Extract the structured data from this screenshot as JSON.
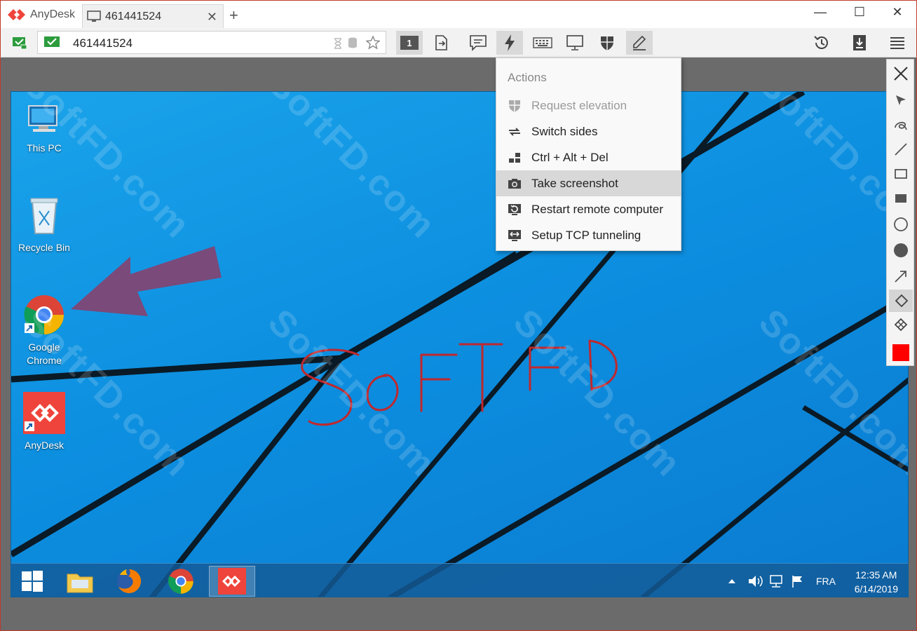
{
  "app": {
    "name": "AnyDesk"
  },
  "tab": {
    "label": "461441524",
    "close": "✕",
    "new_tab": "+"
  },
  "window_controls": {
    "minimize": "—",
    "maximize": "☐",
    "close": "✕"
  },
  "address": {
    "value": "461441524"
  },
  "toolbar": {
    "monitor_number": "1",
    "buttons": [
      "switch-monitor",
      "transfer-files",
      "chat",
      "actions",
      "keyboard",
      "display",
      "permissions",
      "whiteboard",
      "history",
      "install",
      "menu"
    ]
  },
  "actions_menu": {
    "title": "Actions",
    "items": [
      {
        "label": "Request elevation",
        "icon": "shield-icon",
        "disabled": true
      },
      {
        "label": "Switch sides",
        "icon": "switch-icon",
        "disabled": false
      },
      {
        "label": "Ctrl + Alt + Del",
        "icon": "keys-icon",
        "disabled": false
      },
      {
        "label": "Take screenshot",
        "icon": "camera-icon",
        "disabled": false,
        "hovered": true
      },
      {
        "label": "Restart remote computer",
        "icon": "restart-icon",
        "disabled": false
      },
      {
        "label": "Setup TCP tunneling",
        "icon": "tunnel-icon",
        "disabled": false
      }
    ]
  },
  "desktop": {
    "icons": [
      {
        "label": "This PC",
        "icon": "computer-icon"
      },
      {
        "label": "Recycle Bin",
        "icon": "recycle-bin-icon"
      },
      {
        "label_line1": "Google",
        "label_line2": "Chrome",
        "icon": "chrome-icon"
      },
      {
        "label": "AnyDesk",
        "icon": "anydesk-icon"
      }
    ],
    "handwriting": "SoFTFD",
    "arrow_color": "#7a4a7a",
    "wallpaper_color": "#1aa3ea"
  },
  "taskbar": {
    "language": "FRA",
    "time": "12:35 AM",
    "date": "6/14/2019",
    "apps": [
      "start",
      "file-explorer",
      "firefox",
      "chrome",
      "anydesk"
    ]
  },
  "drawing_tools": {
    "tools": [
      "close",
      "pointer",
      "freehand",
      "line",
      "rectangle",
      "filled-rectangle",
      "ellipse",
      "filled-ellipse",
      "arrow",
      "eraser",
      "clear"
    ],
    "selected": "eraser",
    "current_color": "#ff0000"
  },
  "watermark": "SoftFD.com",
  "colors": {
    "accent": "#ef443b",
    "title_border": "#c0392b"
  }
}
